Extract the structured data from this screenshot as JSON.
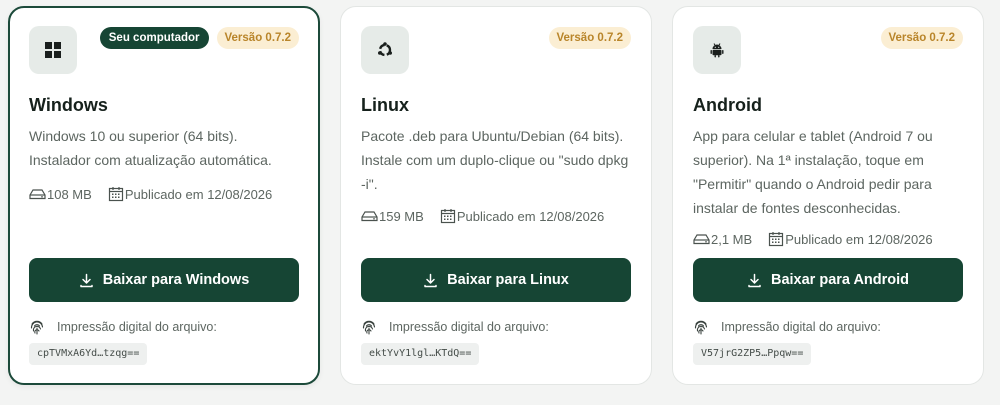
{
  "cards": {
    "windows": {
      "badge_current": "Seu computador",
      "version": "Versão 0.7.2",
      "title": "Windows",
      "description": "Windows 10 ou superior (64 bits). Instalador com atualização automática.",
      "size": "108 MB",
      "published": "Publicado em 12/08/2026",
      "button": "Baixar para Windows",
      "fingerprint_label": "Impressão digital do arquivo:",
      "fingerprint": "cpTVMxA6Yd…tzqg==",
      "icon": "windows-logo-icon"
    },
    "linux": {
      "version": "Versão 0.7.2",
      "title": "Linux",
      "description": "Pacote .deb para Ubuntu/Debian (64 bits). Instale com um duplo-clique ou \"sudo dpkg -i\".",
      "size": "159 MB",
      "published": "Publicado em 12/08/2026",
      "button": "Baixar para Linux",
      "fingerprint_label": "Impressão digital do arquivo:",
      "fingerprint": "ektYvY1lgl…KTdQ==",
      "icon": "ubuntu-logo-icon"
    },
    "android": {
      "version": "Versão 0.7.2",
      "title": "Android",
      "description": "App para celular e tablet (Android 7 ou superior). Na 1ª instalação, toque em \"Permitir\" quando o Android pedir para instalar de fontes desconhecidas.",
      "size": "2,1 MB",
      "published": "Publicado em 12/08/2026",
      "button": "Baixar para Android",
      "fingerprint_label": "Impressão digital do arquivo:",
      "fingerprint": "V57jrG2ZP5…Ppqw==",
      "icon": "android-logo-icon"
    }
  },
  "colors": {
    "primary": "#164534",
    "version_badge_bg": "#fbeed3",
    "version_badge_text": "#b9852a"
  }
}
